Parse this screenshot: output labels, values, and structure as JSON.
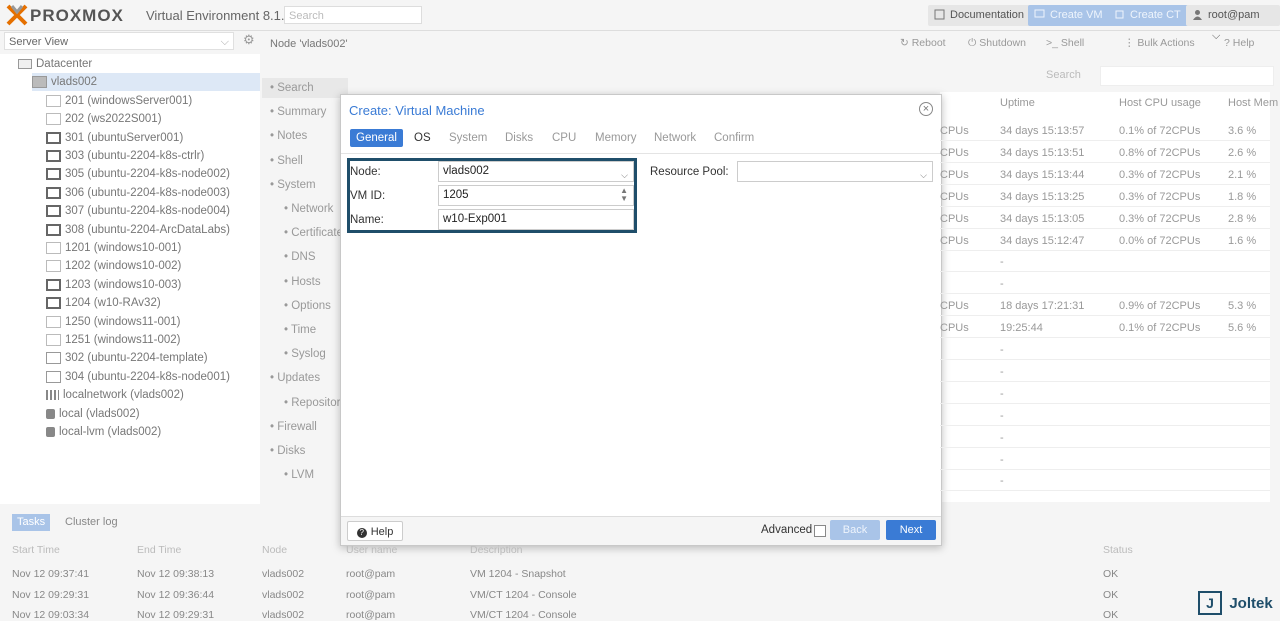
{
  "topbar": {
    "brand": "PROXMOX",
    "version": "Virtual Environment 8.1.4",
    "search_placeholder": "Search",
    "documentation": "Documentation",
    "create_vm": "Create VM",
    "create_ct": "Create CT",
    "user": "root@pam"
  },
  "tree": {
    "view": "Server View",
    "items": [
      {
        "label": "Datacenter",
        "type": "dc"
      },
      {
        "label": "vlads002",
        "type": "node"
      },
      {
        "label": "201 (windowsServer001)",
        "type": "vm"
      },
      {
        "label": "202 (ws2022S001)",
        "type": "vm"
      },
      {
        "label": "301 (ubuntuServer001)",
        "type": "vmon"
      },
      {
        "label": "303 (ubuntu-2204-k8s-ctrlr)",
        "type": "vmon"
      },
      {
        "label": "305 (ubuntu-2204-k8s-node002)",
        "type": "vmon"
      },
      {
        "label": "306 (ubuntu-2204-k8s-node003)",
        "type": "vmon"
      },
      {
        "label": "307 (ubuntu-2204-k8s-node004)",
        "type": "vmon"
      },
      {
        "label": "308 (ubuntu-2204-ArcDataLabs)",
        "type": "vmon"
      },
      {
        "label": "1201 (windows10-001)",
        "type": "vm"
      },
      {
        "label": "1202 (windows10-002)",
        "type": "vm"
      },
      {
        "label": "1203 (windows10-003)",
        "type": "vmon"
      },
      {
        "label": "1204 (w10-RAv32)",
        "type": "vmon"
      },
      {
        "label": "1250 (windows11-001)",
        "type": "vm"
      },
      {
        "label": "1251 (windows11-002)",
        "type": "vm"
      },
      {
        "label": "302 (ubuntu-2204-template)",
        "type": "tpl"
      },
      {
        "label": "304 (ubuntu-2204-k8s-node001)",
        "type": "tpl"
      },
      {
        "label": "localnetwork (vlads002)",
        "type": "net"
      },
      {
        "label": "local (vlads002)",
        "type": "stor"
      },
      {
        "label": "local-lvm (vlads002)",
        "type": "stor"
      }
    ]
  },
  "node_panel": {
    "title": "Node 'vlads002'",
    "actions": [
      "Reboot",
      "Shutdown",
      "Shell",
      "Bulk Actions",
      "Help"
    ],
    "nav": [
      "Search",
      "Summary",
      "Notes",
      "Shell",
      "System",
      "Network",
      "Certificates",
      "DNS",
      "Hosts",
      "Options",
      "Time",
      "Syslog",
      "Updates",
      "Repositories",
      "Firewall",
      "Disks",
      "LVM"
    ],
    "grid_search": "Search",
    "grid_headers": [
      "Uptime",
      "Host CPU usage",
      "Host Mem"
    ],
    "grid_rows": [
      {
        "cpus": "CPUs",
        "uptime": "34 days 15:13:57",
        "cpu": "0.1% of 72CPUs",
        "mem": "3.6 %"
      },
      {
        "cpus": "CPUs",
        "uptime": "34 days 15:13:51",
        "cpu": "0.8% of 72CPUs",
        "mem": "2.6 %"
      },
      {
        "cpus": "CPUs",
        "uptime": "34 days 15:13:44",
        "cpu": "0.3% of 72CPUs",
        "mem": "2.1 %"
      },
      {
        "cpus": "CPUs",
        "uptime": "34 days 15:13:25",
        "cpu": "0.3% of 72CPUs",
        "mem": "1.8 %"
      },
      {
        "cpus": "CPUs",
        "uptime": "34 days 15:13:05",
        "cpu": "0.3% of 72CPUs",
        "mem": "2.8 %"
      },
      {
        "cpus": "CPUs",
        "uptime": "34 days 15:12:47",
        "cpu": "0.0% of 72CPUs",
        "mem": "1.6 %"
      },
      {
        "cpus": "",
        "uptime": "-",
        "cpu": "",
        "mem": ""
      },
      {
        "cpus": "",
        "uptime": "-",
        "cpu": "",
        "mem": ""
      },
      {
        "cpus": "CPUs",
        "uptime": "18 days 17:21:31",
        "cpu": "0.9% of 72CPUs",
        "mem": "5.3 %"
      },
      {
        "cpus": "CPUs",
        "uptime": "19:25:44",
        "cpu": "0.1% of 72CPUs",
        "mem": "5.6 %"
      },
      {
        "cpus": "",
        "uptime": "-",
        "cpu": "",
        "mem": ""
      },
      {
        "cpus": "",
        "uptime": "-",
        "cpu": "",
        "mem": ""
      },
      {
        "cpus": "",
        "uptime": "-",
        "cpu": "",
        "mem": ""
      },
      {
        "cpus": "",
        "uptime": "-",
        "cpu": "",
        "mem": ""
      },
      {
        "cpus": "",
        "uptime": "-",
        "cpu": "",
        "mem": ""
      },
      {
        "cpus": "",
        "uptime": "-",
        "cpu": "",
        "mem": ""
      },
      {
        "cpus": "",
        "uptime": "-",
        "cpu": "",
        "mem": ""
      }
    ]
  },
  "dialog": {
    "title": "Create: Virtual Machine",
    "tabs": [
      "General",
      "OS",
      "System",
      "Disks",
      "CPU",
      "Memory",
      "Network",
      "Confirm"
    ],
    "node_label": "Node:",
    "node_value": "vlads002",
    "vmid_label": "VM ID:",
    "vmid_value": "1205",
    "name_label": "Name:",
    "name_value": "w10-Exp001",
    "pool_label": "Resource Pool:",
    "pool_value": "",
    "help": "Help",
    "advanced": "Advanced",
    "back": "Back",
    "next": "Next"
  },
  "tasks": {
    "tabs": [
      "Tasks",
      "Cluster log"
    ],
    "headers": [
      "Start Time",
      "End Time",
      "Node",
      "User name",
      "Description",
      "Status"
    ],
    "rows": [
      {
        "start": "Nov 12 09:37:41",
        "end": "Nov 12 09:38:13",
        "node": "vlads002",
        "user": "root@pam",
        "desc": "VM 1204 - Snapshot",
        "status": "OK"
      },
      {
        "start": "Nov 12 09:29:31",
        "end": "Nov 12 09:36:44",
        "node": "vlads002",
        "user": "root@pam",
        "desc": "VM/CT 1204 - Console",
        "status": "OK"
      },
      {
        "start": "Nov 12 09:03:34",
        "end": "Nov 12 09:29:31",
        "node": "vlads002",
        "user": "root@pam",
        "desc": "VM/CT 1204 - Console",
        "status": "OK"
      }
    ]
  },
  "watermark": {
    "text": "Joltek",
    "glyph": "J"
  },
  "colors": {
    "accent": "#3a7bd5",
    "highlight_border": "#1f4e6a"
  }
}
